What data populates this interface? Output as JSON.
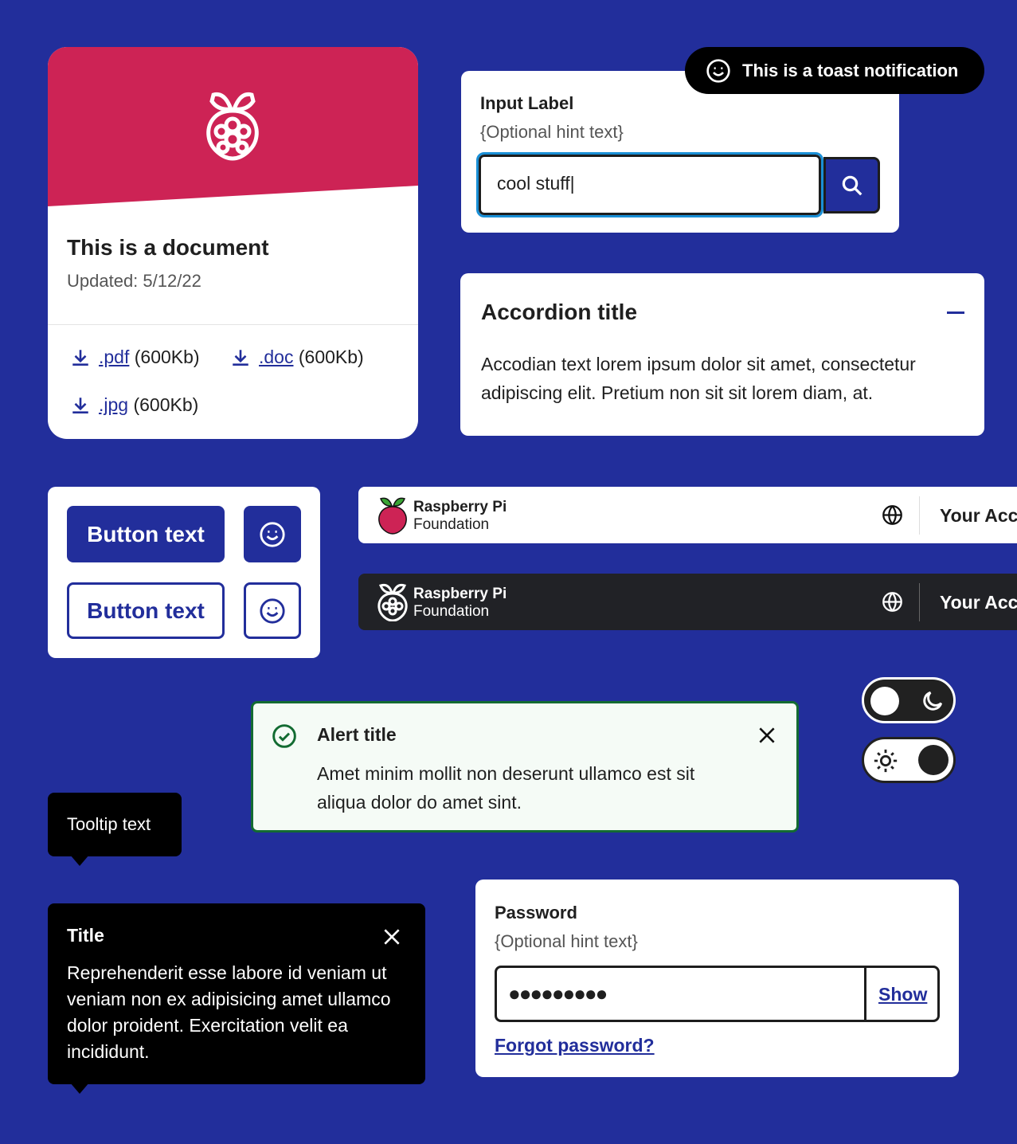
{
  "colors": {
    "background": "#222e9b",
    "brand_red": "#cd2355",
    "primary": "#222e9b",
    "dark": "#212121",
    "success": "#136b32"
  },
  "document_card": {
    "title": "This is a document",
    "updated": "Updated: 5/12/22",
    "icon": "raspberry-logo-icon",
    "files": [
      {
        "ext": ".pdf",
        "size": "(600Kb)"
      },
      {
        "ext": ".doc",
        "size": "(600Kb)"
      },
      {
        "ext": ".jpg",
        "size": "(600Kb)"
      }
    ]
  },
  "toast": {
    "text": "This is a toast notification",
    "icon": "smiley-icon"
  },
  "search_input": {
    "label": "Input Label",
    "hint": "{Optional hint text}",
    "value": "cool stuff|",
    "icon": "search-icon"
  },
  "accordion": {
    "title": "Accordion title",
    "body": "Accodian text lorem ipsum dolor sit amet, consectetur adipiscing elit. Pretium non sit sit lorem diam, at.",
    "icon": "minus-icon"
  },
  "buttons": {
    "primary_label": "Button text",
    "secondary_label": "Button text",
    "icon": "smiley-icon"
  },
  "header_light": {
    "brand_line1": "Raspberry Pi",
    "brand_line2": "Foundation",
    "account": "Your Acc",
    "icon": "globe-icon"
  },
  "header_dark": {
    "brand_line1": "Raspberry Pi",
    "brand_line2": "Foundation",
    "account": "Your Acc",
    "icon": "globe-icon"
  },
  "theme_toggles": [
    {
      "state": "dark",
      "icon": "moon-icon"
    },
    {
      "state": "light",
      "icon": "sun-icon"
    }
  ],
  "alert": {
    "title": "Alert title",
    "body": "Amet minim mollit non deserunt ullamco est sit aliqua dolor do amet sint.",
    "icon": "check-circle-icon"
  },
  "tooltip": {
    "text": "Tooltip text"
  },
  "dialog_tooltip": {
    "title": "Title",
    "body": "Reprehenderit esse labore id veniam ut veniam non ex adipisicing amet ullamco dolor proident. Exercitation velit ea incididunt."
  },
  "password": {
    "label": "Password",
    "hint": "{Optional hint text}",
    "value": "●●●●●●●●●",
    "show_label": "Show",
    "forgot_label": "Forgot password?"
  }
}
